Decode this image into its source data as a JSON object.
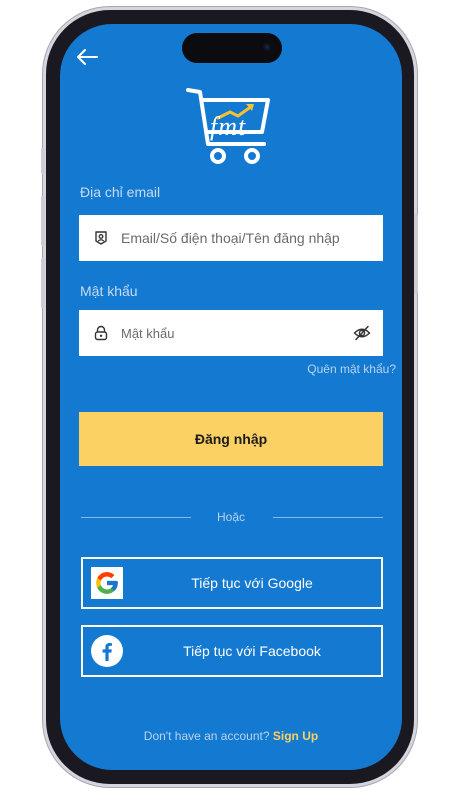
{
  "logo": {
    "text": "fmt"
  },
  "email": {
    "label": "Địa chỉ email",
    "placeholder": "Email/Số điện thoại/Tên đăng nhập",
    "icon": "account-icon"
  },
  "password": {
    "label": "Mật khẩu",
    "placeholder": "Mật khẩu",
    "icon": "lock-icon",
    "toggle_icon": "eye-off-icon"
  },
  "forgot_password": "Quên mật khẩu?",
  "login_button": "Đăng nhập",
  "divider": "Hoặc",
  "social": {
    "google": "Tiếp tục với Google",
    "facebook": "Tiếp tục với Facebook"
  },
  "signup": {
    "prompt": "Don't have an account?",
    "link": "Sign Up"
  },
  "colors": {
    "background": "#1479d0",
    "accent": "#fbd164",
    "input_bg": "#ffffff"
  }
}
